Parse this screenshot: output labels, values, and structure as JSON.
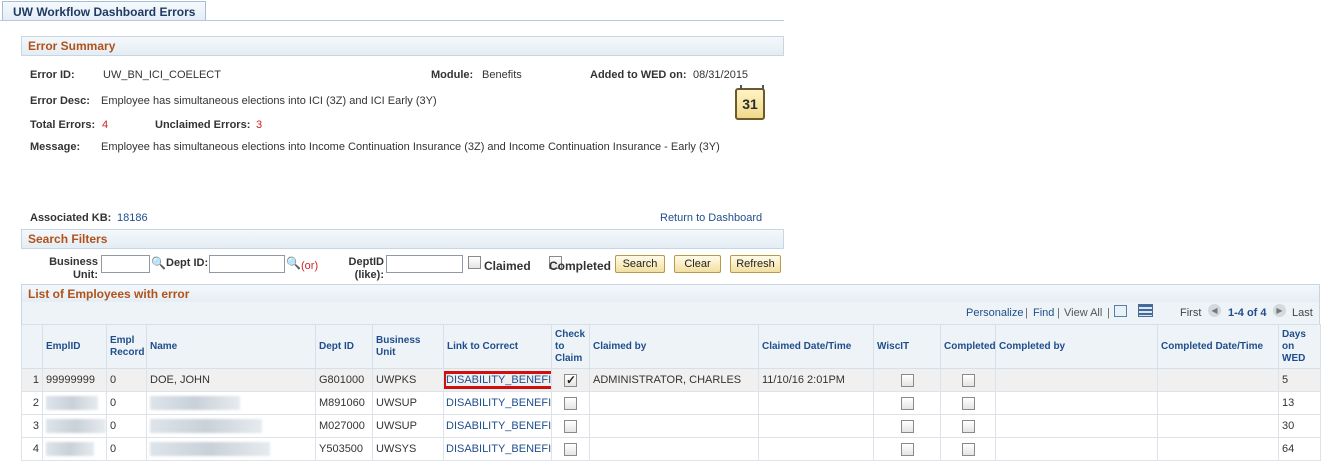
{
  "page_tab": "UW Workflow Dashboard Errors",
  "error_summary": {
    "header": "Error Summary",
    "error_id_label": "Error ID:",
    "error_id": "UW_BN_ICI_COELECT",
    "module_label": "Module:",
    "module": "Benefits",
    "added_label": "Added to WED on:",
    "added_date": "08/31/2015",
    "calendar_icon_text": "31",
    "error_desc_label": "Error Desc:",
    "error_desc": "Employee has simultaneous elections into ICI (3Z) and ICI Early (3Y)",
    "total_errors_label": "Total Errors:",
    "total_errors": "4",
    "unclaimed_label": "Unclaimed Errors:",
    "unclaimed_errors": "3",
    "message_label": "Message:",
    "message": "Employee has simultaneous elections into Income Continuation Insurance (3Z) and Income Continuation Insurance - Early (3Y)",
    "kb_label": "Associated KB:",
    "kb_value": "18186",
    "return_link": "Return to Dashboard"
  },
  "search_filters": {
    "header": "Search Filters",
    "business_unit_label_1": "Business",
    "business_unit_label_2": "Unit:",
    "business_unit_value": "",
    "dept_id_label": "Dept ID:",
    "dept_id_value": "",
    "or_text": "(or)",
    "deptid_like_label_1": "DeptID",
    "deptid_like_label_2": "(like):",
    "deptid_like_value": "",
    "claimed_label": "Claimed",
    "completed_label": "Completed",
    "search_button": "Search",
    "clear_button": "Clear",
    "refresh_button": "Refresh"
  },
  "employee_list": {
    "header": "List of Employees with error",
    "nav": {
      "personalize": "Personalize",
      "find": "Find",
      "view_all": "View All",
      "first": "First",
      "range": "1-4 of 4",
      "last": "Last"
    },
    "columns": [
      "EmplID",
      "Empl Record",
      "Name",
      "Dept ID",
      "Business Unit",
      "Link to Correct",
      "Check to Claim",
      "Claimed by",
      "Claimed Date/Time",
      "WiscIT",
      "Completed",
      "Completed by",
      "Completed Date/Time",
      "Days on WED"
    ],
    "rows": [
      {
        "num": "1",
        "emplid": "99999999",
        "record": "0",
        "name": "DOE, JOHN",
        "dept": "G801000",
        "bu": "UWPKS",
        "link": "DISABILITY_BENEFIT",
        "claim": true,
        "claimed_by": "ADMINISTRATOR, CHARLES",
        "claimed_dt": "11/10/16  2:01PM",
        "wiscit": false,
        "completed": false,
        "completed_by": "",
        "completed_dt": "",
        "days": "5"
      },
      {
        "num": "2",
        "emplid": "",
        "record": "0",
        "name": "",
        "dept": "M891060",
        "bu": "UWSUP",
        "link": "DISABILITY_BENEFIT",
        "claim": false,
        "claimed_by": "",
        "claimed_dt": "",
        "wiscit": false,
        "completed": false,
        "completed_by": "",
        "completed_dt": "",
        "days": "13"
      },
      {
        "num": "3",
        "emplid": "",
        "record": "0",
        "name": "",
        "dept": "M027000",
        "bu": "UWSUP",
        "link": "DISABILITY_BENEFIT",
        "claim": false,
        "claimed_by": "",
        "claimed_dt": "",
        "wiscit": false,
        "completed": false,
        "completed_by": "",
        "completed_dt": "",
        "days": "30"
      },
      {
        "num": "4",
        "emplid": "",
        "record": "0",
        "name": "",
        "dept": "Y503500",
        "bu": "UWSYS",
        "link": "DISABILITY_BENEFIT",
        "claim": false,
        "claimed_by": "",
        "claimed_dt": "",
        "wiscit": false,
        "completed": false,
        "completed_by": "",
        "completed_dt": "",
        "days": "64"
      }
    ]
  },
  "colors": {
    "section_title": "#b0521a",
    "link": "#1f4e8c",
    "highlight": "#d01010"
  }
}
